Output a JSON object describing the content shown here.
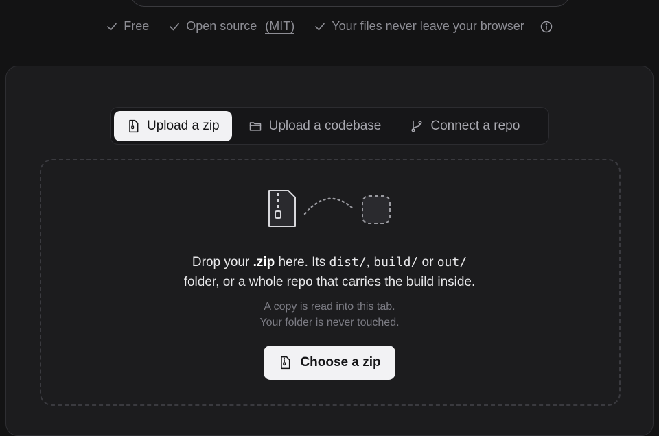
{
  "features": {
    "free": "Free",
    "open_source": "Open source",
    "license": "(MIT)",
    "privacy": "Your files never leave your browser"
  },
  "tabs": [
    {
      "label": "Upload a  zip",
      "icon": "file-zip-icon",
      "active": true
    },
    {
      "label": "Upload a  codebase",
      "icon": "folder-icon",
      "active": false
    },
    {
      "label": "Connect a  repo",
      "icon": "git-branch-icon",
      "active": false
    }
  ],
  "dropzone": {
    "line1_pre": "Drop your ",
    "line1_zip": ".zip",
    "line1_mid": " here. Its ",
    "dist": "dist/",
    "comma": ", ",
    "build": "build/",
    "or": " or ",
    "out": "out/",
    "line2": "folder, or a whole repo that carries the build inside.",
    "sub1": "A copy is read into this tab.",
    "sub2": "Your folder is never touched.",
    "button": "Choose a zip"
  },
  "colors": {
    "background": "#131314",
    "card": "#1c1c1e",
    "active_tab": "#f2f2f4",
    "muted_text": "#8d8d94"
  }
}
